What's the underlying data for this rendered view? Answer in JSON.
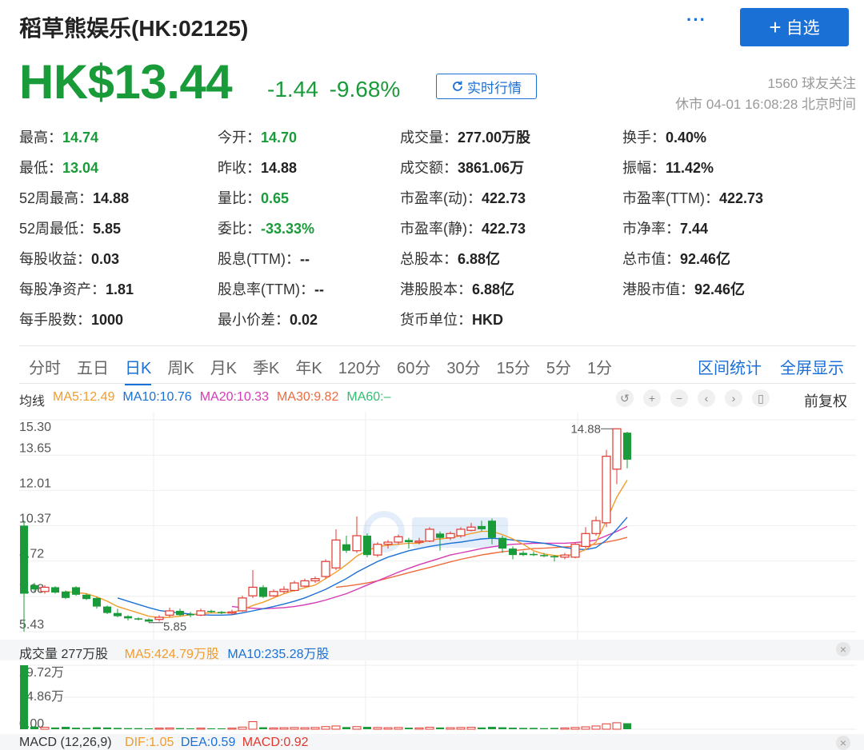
{
  "header": {
    "title": "稻草熊娱乐(HK:02125)",
    "more": "···",
    "follow_button": "自选",
    "follow_plus": "+",
    "price": "HK$13.44",
    "change": "-1.44",
    "change_pct": "-9.68%",
    "realtime_button": "实时行情",
    "followers": "1560 球友关注",
    "market_time": "休市 04-01 16:08:28 北京时间"
  },
  "stats": [
    {
      "label": "最高：",
      "value": "14.74",
      "green": true
    },
    {
      "label": "今开：",
      "value": "14.70",
      "green": true
    },
    {
      "label": "成交量：",
      "value": "277.00万股",
      "green": false
    },
    {
      "label": "换手：",
      "value": "0.40%",
      "green": false
    },
    {
      "label": "最低：",
      "value": "13.04",
      "green": true
    },
    {
      "label": "昨收：",
      "value": "14.88",
      "green": false
    },
    {
      "label": "成交额：",
      "value": "3861.06万",
      "green": false
    },
    {
      "label": "振幅：",
      "value": "11.42%",
      "green": false
    },
    {
      "label": "52周最高：",
      "value": "14.88",
      "green": false
    },
    {
      "label": "量比：",
      "value": "0.65",
      "green": true
    },
    {
      "label": "市盈率(动)：",
      "value": "422.73",
      "green": false
    },
    {
      "label": "市盈率(TTM)：",
      "value": "422.73",
      "green": false
    },
    {
      "label": "52周最低：",
      "value": "5.85",
      "green": false
    },
    {
      "label": "委比：",
      "value": "-33.33%",
      "green": true
    },
    {
      "label": "市盈率(静)：",
      "value": "422.73",
      "green": false
    },
    {
      "label": "市净率：",
      "value": "7.44",
      "green": false
    },
    {
      "label": "每股收益：",
      "value": "0.03",
      "green": false
    },
    {
      "label": "股息(TTM)：",
      "value": "--",
      "green": false
    },
    {
      "label": "总股本：",
      "value": "6.88亿",
      "green": false
    },
    {
      "label": "总市值：",
      "value": "92.46亿",
      "green": false
    },
    {
      "label": "每股净资产：",
      "value": "1.81",
      "green": false
    },
    {
      "label": "股息率(TTM)：",
      "value": "--",
      "green": false
    },
    {
      "label": "港股股本：",
      "value": "6.88亿",
      "green": false
    },
    {
      "label": "港股市值：",
      "value": "92.46亿",
      "green": false
    },
    {
      "label": "每手股数：",
      "value": "1000",
      "green": false
    },
    {
      "label": "最小价差：",
      "value": "0.02",
      "green": false
    },
    {
      "label": "货币单位：",
      "value": "HKD",
      "green": false
    }
  ],
  "tabs": [
    "分时",
    "五日",
    "日K",
    "周K",
    "月K",
    "季K",
    "年K",
    "120分",
    "60分",
    "30分",
    "15分",
    "5分",
    "1分"
  ],
  "active_tab": "日K",
  "tab_actions": [
    "区间统计",
    "全屏显示"
  ],
  "ma_legend": {
    "label": "均线",
    "items": [
      {
        "text": "MA5:12.49",
        "color": "#f39c2b"
      },
      {
        "text": "MA10:10.76",
        "color": "#1b70d6"
      },
      {
        "text": "MA20:10.33",
        "color": "#d63ab5"
      },
      {
        "text": "MA30:9.82",
        "color": "#ef6a3c"
      },
      {
        "text": "MA60:–",
        "color": "#2fbf71"
      }
    ]
  },
  "toolbar": {
    "icons": [
      "undo-icon",
      "zoom-in-icon",
      "zoom-out-icon",
      "left-icon",
      "right-icon",
      "candle-icon"
    ],
    "fq_label": "前复权"
  },
  "price_axis": [
    "15.30",
    "13.65",
    "12.01",
    "10.37",
    "8.72",
    "7.08",
    "5.43"
  ],
  "annotations": {
    "high": "14.88",
    "low": "5.85"
  },
  "volume": {
    "label": "成交量 277万股",
    "ma5": "MA5:424.79万股",
    "ma10": "MA10:235.28万股",
    "axis": [
      "29.72万",
      "14.86万",
      "0.00"
    ]
  },
  "macd": {
    "label": "MACD (12,26,9)",
    "dif": "DIF:1.05",
    "dea": "DEA:0.59",
    "macd": "MACD:0.92"
  },
  "colors": {
    "up": "#e0382f",
    "down": "#1a9b3a",
    "accent": "#1b70d6"
  },
  "chart_data": {
    "type": "candlestick",
    "ylim": [
      5.43,
      15.3
    ],
    "candles": [
      {
        "o": 10.37,
        "c": 7.2,
        "h": 10.6,
        "l": 5.43
      },
      {
        "o": 7.6,
        "c": 7.4,
        "h": 7.7,
        "l": 7.3
      },
      {
        "o": 7.3,
        "c": 7.5,
        "h": 7.6,
        "l": 7.2
      },
      {
        "o": 7.5,
        "c": 7.25,
        "h": 7.55,
        "l": 7.2
      },
      {
        "o": 7.3,
        "c": 7.0,
        "h": 7.35,
        "l": 6.95
      },
      {
        "o": 7.5,
        "c": 7.15,
        "h": 7.55,
        "l": 7.1
      },
      {
        "o": 7.15,
        "c": 6.95,
        "h": 7.2,
        "l": 6.9
      },
      {
        "o": 7.0,
        "c": 6.6,
        "h": 7.05,
        "l": 6.5
      },
      {
        "o": 6.6,
        "c": 6.3,
        "h": 6.65,
        "l": 6.25
      },
      {
        "o": 6.3,
        "c": 6.15,
        "h": 6.5,
        "l": 6.1
      },
      {
        "o": 6.15,
        "c": 6.05,
        "h": 6.2,
        "l": 5.95
      },
      {
        "o": 6.05,
        "c": 6.0,
        "h": 6.1,
        "l": 5.95
      },
      {
        "o": 6.0,
        "c": 5.9,
        "h": 6.05,
        "l": 5.85
      },
      {
        "o": 6.0,
        "c": 6.1,
        "h": 6.2,
        "l": 5.9
      },
      {
        "o": 6.2,
        "c": 6.4,
        "h": 6.55,
        "l": 6.1
      },
      {
        "o": 6.4,
        "c": 6.2,
        "h": 6.5,
        "l": 6.15
      },
      {
        "o": 6.25,
        "c": 6.2,
        "h": 6.35,
        "l": 6.1
      },
      {
        "o": 6.2,
        "c": 6.4,
        "h": 6.5,
        "l": 6.15
      },
      {
        "o": 6.4,
        "c": 6.35,
        "h": 6.45,
        "l": 6.3
      },
      {
        "o": 6.35,
        "c": 6.3,
        "h": 6.4,
        "l": 6.25
      },
      {
        "o": 6.3,
        "c": 6.35,
        "h": 6.45,
        "l": 6.2
      },
      {
        "o": 6.4,
        "c": 7.0,
        "h": 7.1,
        "l": 6.35
      },
      {
        "o": 7.1,
        "c": 7.5,
        "h": 8.3,
        "l": 7.0
      },
      {
        "o": 7.5,
        "c": 7.05,
        "h": 7.6,
        "l": 7.0
      },
      {
        "o": 7.1,
        "c": 7.3,
        "h": 7.4,
        "l": 7.05
      },
      {
        "o": 7.3,
        "c": 7.4,
        "h": 7.55,
        "l": 7.2
      },
      {
        "o": 7.35,
        "c": 7.7,
        "h": 7.8,
        "l": 7.3
      },
      {
        "o": 7.55,
        "c": 7.8,
        "h": 7.9,
        "l": 7.5
      },
      {
        "o": 7.8,
        "c": 7.9,
        "h": 8.0,
        "l": 7.7
      },
      {
        "o": 8.0,
        "c": 8.7,
        "h": 8.8,
        "l": 7.9
      },
      {
        "o": 8.4,
        "c": 9.7,
        "h": 10.2,
        "l": 8.3
      },
      {
        "o": 9.5,
        "c": 9.2,
        "h": 9.9,
        "l": 9.1
      },
      {
        "o": 9.2,
        "c": 9.9,
        "h": 10.8,
        "l": 9.1
      },
      {
        "o": 9.9,
        "c": 9.0,
        "h": 10.0,
        "l": 8.9
      },
      {
        "o": 9.0,
        "c": 9.5,
        "h": 9.6,
        "l": 8.9
      },
      {
        "o": 9.5,
        "c": 9.6,
        "h": 9.7,
        "l": 9.3
      },
      {
        "o": 9.6,
        "c": 9.85,
        "h": 9.95,
        "l": 9.5
      },
      {
        "o": 9.7,
        "c": 9.6,
        "h": 9.8,
        "l": 9.3
      },
      {
        "o": 9.6,
        "c": 9.65,
        "h": 9.8,
        "l": 9.5
      },
      {
        "o": 9.65,
        "c": 10.2,
        "h": 10.3,
        "l": 9.6
      },
      {
        "o": 10.0,
        "c": 9.8,
        "h": 10.1,
        "l": 9.2
      },
      {
        "o": 9.8,
        "c": 10.0,
        "h": 10.1,
        "l": 9.7
      },
      {
        "o": 9.9,
        "c": 10.2,
        "h": 10.3,
        "l": 9.8
      },
      {
        "o": 10.15,
        "c": 10.3,
        "h": 10.5,
        "l": 10.1
      },
      {
        "o": 10.35,
        "c": 10.2,
        "h": 10.6,
        "l": 10.1
      },
      {
        "o": 10.6,
        "c": 9.8,
        "h": 10.7,
        "l": 9.5
      },
      {
        "o": 9.8,
        "c": 9.3,
        "h": 9.9,
        "l": 9.1
      },
      {
        "o": 9.3,
        "c": 9.0,
        "h": 9.4,
        "l": 8.8
      },
      {
        "o": 9.1,
        "c": 9.0,
        "h": 9.2,
        "l": 8.95
      },
      {
        "o": 9.05,
        "c": 9.0,
        "h": 9.15,
        "l": 8.95
      },
      {
        "o": 9.0,
        "c": 8.95,
        "h": 9.1,
        "l": 8.9
      },
      {
        "o": 8.95,
        "c": 8.9,
        "h": 9.0,
        "l": 8.7
      },
      {
        "o": 8.9,
        "c": 9.0,
        "h": 9.1,
        "l": 8.8
      },
      {
        "o": 8.9,
        "c": 9.5,
        "h": 9.6,
        "l": 8.85
      },
      {
        "o": 9.4,
        "c": 10.0,
        "h": 10.3,
        "l": 9.3
      },
      {
        "o": 10.0,
        "c": 10.6,
        "h": 10.8,
        "l": 9.9
      },
      {
        "o": 10.5,
        "c": 13.6,
        "h": 13.9,
        "l": 10.3
      },
      {
        "o": 13.0,
        "c": 14.88,
        "h": 14.88,
        "l": 12.3
      },
      {
        "o": 14.7,
        "c": 13.44,
        "h": 14.74,
        "l": 13.04
      }
    ],
    "ma5": [
      null,
      null,
      null,
      null,
      7.3,
      7.25,
      7.2,
      7.05,
      6.85,
      6.6,
      6.45,
      6.3,
      6.15,
      6.08,
      6.1,
      6.15,
      6.22,
      6.28,
      6.3,
      6.3,
      6.32,
      6.45,
      6.65,
      6.8,
      7.0,
      7.2,
      7.35,
      7.48,
      7.6,
      7.9,
      8.2,
      8.55,
      8.95,
      9.2,
      9.4,
      9.45,
      9.5,
      9.55,
      9.55,
      9.7,
      9.75,
      9.8,
      9.9,
      10.0,
      10.1,
      10.1,
      9.95,
      9.75,
      9.5,
      9.2,
      9.05,
      8.98,
      8.95,
      9.05,
      9.25,
      9.6,
      10.6,
      11.7,
      12.49
    ],
    "ma10": [
      null,
      null,
      null,
      null,
      null,
      null,
      null,
      null,
      null,
      7.0,
      6.85,
      6.7,
      6.55,
      6.42,
      6.35,
      6.3,
      6.25,
      6.22,
      6.2,
      6.2,
      6.22,
      6.3,
      6.4,
      6.5,
      6.6,
      6.72,
      6.85,
      7.0,
      7.2,
      7.4,
      7.65,
      7.9,
      8.2,
      8.45,
      8.7,
      8.9,
      9.05,
      9.2,
      9.3,
      9.4,
      9.48,
      9.55,
      9.6,
      9.68,
      9.75,
      9.78,
      9.75,
      9.7,
      9.65,
      9.6,
      9.55,
      9.45,
      9.35,
      9.28,
      9.25,
      9.35,
      9.7,
      10.2,
      10.76
    ],
    "ma20": [
      null,
      null,
      null,
      null,
      null,
      null,
      null,
      null,
      null,
      null,
      null,
      null,
      null,
      null,
      null,
      null,
      null,
      null,
      null,
      null,
      6.6,
      6.55,
      6.52,
      6.5,
      6.52,
      6.55,
      6.6,
      6.68,
      6.78,
      6.9,
      7.05,
      7.2,
      7.4,
      7.6,
      7.8,
      8.0,
      8.2,
      8.38,
      8.55,
      8.7,
      8.85,
      9.0,
      9.1,
      9.2,
      9.3,
      9.38,
      9.45,
      9.5,
      9.52,
      9.55,
      9.55,
      9.55,
      9.55,
      9.58,
      9.62,
      9.7,
      9.9,
      10.1,
      10.33
    ],
    "ma30": [
      null,
      null,
      null,
      null,
      null,
      null,
      null,
      null,
      null,
      null,
      null,
      null,
      null,
      null,
      null,
      null,
      null,
      null,
      null,
      null,
      null,
      null,
      null,
      null,
      null,
      null,
      null,
      null,
      null,
      null,
      7.5,
      7.55,
      7.62,
      7.7,
      7.8,
      7.92,
      8.05,
      8.18,
      8.3,
      8.42,
      8.55,
      8.68,
      8.8,
      8.9,
      9.0,
      9.08,
      9.15,
      9.2,
      9.25,
      9.3,
      9.32,
      9.35,
      9.38,
      9.4,
      9.45,
      9.5,
      9.6,
      9.7,
      9.82
    ],
    "volume": [
      29.72,
      1.2,
      0.9,
      0.8,
      1.1,
      0.7,
      0.6,
      0.9,
      0.8,
      0.6,
      0.5,
      0.5,
      0.4,
      0.5,
      0.6,
      0.5,
      0.4,
      0.5,
      0.4,
      0.4,
      0.5,
      1.0,
      3.5,
      0.9,
      0.6,
      0.7,
      0.8,
      0.7,
      0.8,
      1.2,
      1.5,
      1.0,
      1.2,
      1.1,
      0.8,
      0.7,
      0.8,
      0.7,
      0.6,
      0.9,
      0.8,
      0.7,
      0.8,
      0.9,
      0.8,
      1.1,
      0.9,
      0.7,
      0.6,
      0.6,
      0.5,
      0.6,
      0.6,
      0.8,
      1.1,
      1.5,
      2.5,
      3.0,
      2.77
    ],
    "volume_ylim": [
      0,
      29.72
    ]
  }
}
